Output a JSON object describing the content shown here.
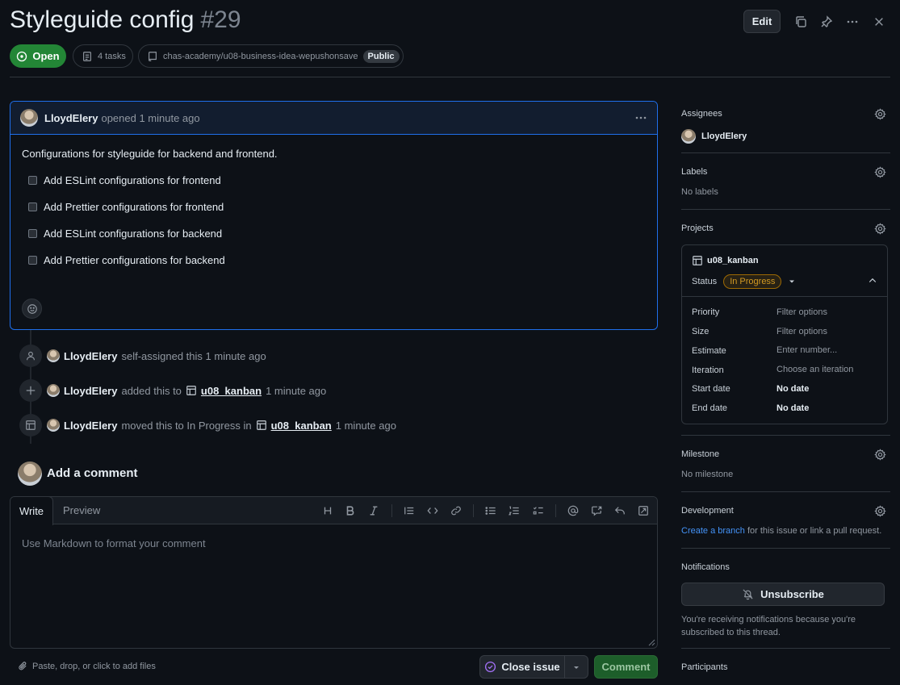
{
  "issue": {
    "title": "Styleguide config",
    "number": "#29"
  },
  "header": {
    "edit_label": "Edit",
    "status_label": "Open",
    "tasks_label": "4 tasks",
    "repo": "chas-academy/u08-business-idea-wepushonsave",
    "visibility": "Public"
  },
  "comment": {
    "author": "LloydElery",
    "meta": "opened 1 minute ago",
    "body": "Configurations for styleguide for backend and frontend.",
    "tasks": [
      "Add ESLint configurations for frontend",
      "Add Prettier configurations for frontend",
      "Add ESLint configurations for backend",
      "Add Prettier configurations for backend"
    ]
  },
  "timeline": [
    {
      "user": "LloydElery",
      "action": "self-assigned this 1 minute ago"
    },
    {
      "user": "LloydElery",
      "action": "added this to",
      "project": "u08_kanban",
      "time": "1 minute ago"
    },
    {
      "user": "LloydElery",
      "action": "moved this to In Progress in",
      "project": "u08_kanban",
      "time": "1 minute ago"
    }
  ],
  "add_comment": {
    "title": "Add a comment",
    "write_tab": "Write",
    "preview_tab": "Preview",
    "placeholder": "Use Markdown to format your comment",
    "paste_hint": "Paste, drop, or click to add files",
    "close_label": "Close issue",
    "comment_label": "Comment"
  },
  "sidebar": {
    "assignees_label": "Assignees",
    "assignee": "LloydElery",
    "labels_label": "Labels",
    "labels_value": "No labels",
    "projects_label": "Projects",
    "project": {
      "name": "u08_kanban",
      "status_label": "Status",
      "status_value": "In Progress",
      "fields": [
        {
          "name": "Priority",
          "value": "Filter options"
        },
        {
          "name": "Size",
          "value": "Filter options"
        },
        {
          "name": "Estimate",
          "value": "Enter number..."
        },
        {
          "name": "Iteration",
          "value": "Choose an iteration"
        },
        {
          "name": "Start date",
          "value": "No date"
        },
        {
          "name": "End date",
          "value": "No date"
        }
      ]
    },
    "milestone_label": "Milestone",
    "milestone_value": "No milestone",
    "development_label": "Development",
    "development_link": "Create a branch",
    "development_rest": " for this issue or link a pull request.",
    "notifications_label": "Notifications",
    "unsubscribe_label": "Unsubscribe",
    "notifications_text": "You're receiving notifications because you're subscribed to this thread.",
    "participants_label": "Participants"
  },
  "colors": {
    "open_green": "#238636",
    "accent_blue": "#1f6feb",
    "status_amber": "#d29922"
  }
}
